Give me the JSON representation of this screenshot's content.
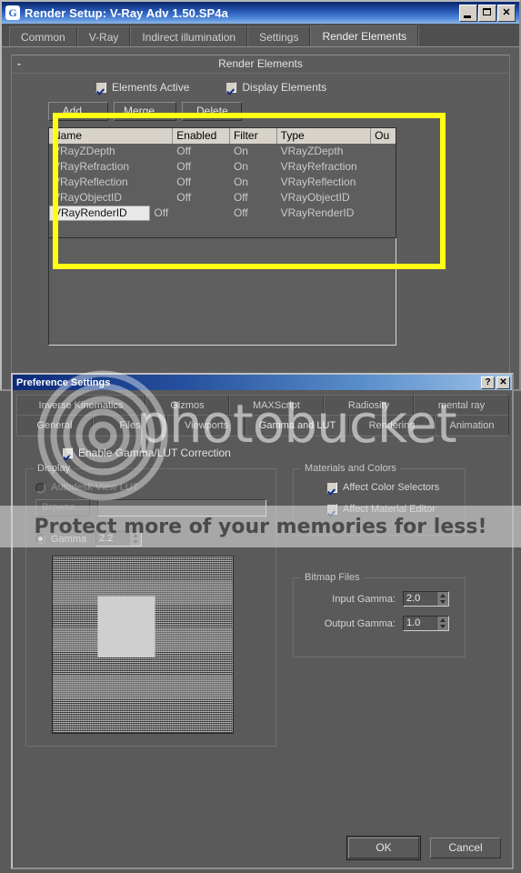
{
  "render_setup": {
    "title": "Render Setup: V-Ray Adv 1.50.SP4a",
    "logo_glyph": "G",
    "window_buttons": {
      "minimize": "_",
      "maximize": "□",
      "close": "✕"
    },
    "tabs": [
      {
        "label": "Common",
        "active": false
      },
      {
        "label": "V-Ray",
        "active": false
      },
      {
        "label": "Indirect illumination",
        "active": false
      },
      {
        "label": "Settings",
        "active": false
      },
      {
        "label": "Render Elements",
        "active": true
      }
    ],
    "rollout": {
      "title": "Render Elements",
      "collapse_glyph": "-"
    },
    "checkboxes": [
      {
        "label": "Elements Active",
        "checked": true
      },
      {
        "label": "Display Elements",
        "checked": true
      }
    ],
    "buttons": [
      {
        "label": "Add ..."
      },
      {
        "label": "Merge ..."
      },
      {
        "label": "Delete"
      }
    ],
    "table": {
      "columns": [
        "Name",
        "Enabled",
        "Filter",
        "Type",
        "Ou"
      ],
      "rows": [
        {
          "name": "VRayZDepth",
          "enabled": "Off",
          "filter": "On",
          "type": "VRayZDepth",
          "selected": false
        },
        {
          "name": "VRayRefraction",
          "enabled": "Off",
          "filter": "On",
          "type": "VRayRefraction",
          "selected": false
        },
        {
          "name": "VRayReflection",
          "enabled": "Off",
          "filter": "On",
          "type": "VRayReflection",
          "selected": false
        },
        {
          "name": "VRayObjectID",
          "enabled": "Off",
          "filter": "Off",
          "type": "VRayObjectID",
          "selected": false
        },
        {
          "name": "VRayRenderID",
          "enabled": "Off",
          "filter": "Off",
          "type": "VRayRenderID",
          "selected": true
        }
      ]
    }
  },
  "annotation": {
    "color": "#ffff14",
    "shape": "rectangle-highlight"
  },
  "preferences": {
    "title": "Preference Settings",
    "window_buttons": {
      "help": "?",
      "close": "✕"
    },
    "tabs_row1": [
      {
        "label": "Inverse Kinematics",
        "active": false
      },
      {
        "label": "Gizmos",
        "active": false
      },
      {
        "label": "MAXScript",
        "active": false
      },
      {
        "label": "Radiosity",
        "active": false
      },
      {
        "label": "mental ray",
        "active": false
      }
    ],
    "tabs_row2": [
      {
        "label": "General",
        "active": false
      },
      {
        "label": "Files",
        "active": false
      },
      {
        "label": "Viewports",
        "active": false
      },
      {
        "label": "Gamma and LUT",
        "active": true
      },
      {
        "label": "Rendering",
        "active": false
      },
      {
        "label": "Animation",
        "active": false
      }
    ],
    "enable_gamma": {
      "label": "Enable Gamma/LUT Correction",
      "checked": true
    },
    "display_group": {
      "legend": "Display",
      "lut_option": {
        "label": "Autodesk View LUT",
        "selected": false
      },
      "browse_label": "Browse...",
      "lut_path_value": "",
      "gamma_option": {
        "label": "Gamma",
        "selected": true
      },
      "gamma_value": "2.2"
    },
    "materials_group": {
      "legend": "Materials and Colors",
      "items": [
        {
          "label": "Affect Color Selectors",
          "checked": true
        },
        {
          "label": "Affect Material Editor",
          "checked": true
        }
      ]
    },
    "bitmap_group": {
      "legend": "Bitmap Files",
      "input_label": "Input Gamma:",
      "input_value": "2.0",
      "output_label": "Output Gamma:",
      "output_value": "1.0"
    },
    "footer": {
      "ok_label": "OK",
      "cancel_label": "Cancel"
    }
  },
  "watermark": {
    "brand": "photobucket",
    "tagline": "Protect more of your memories for less!"
  }
}
